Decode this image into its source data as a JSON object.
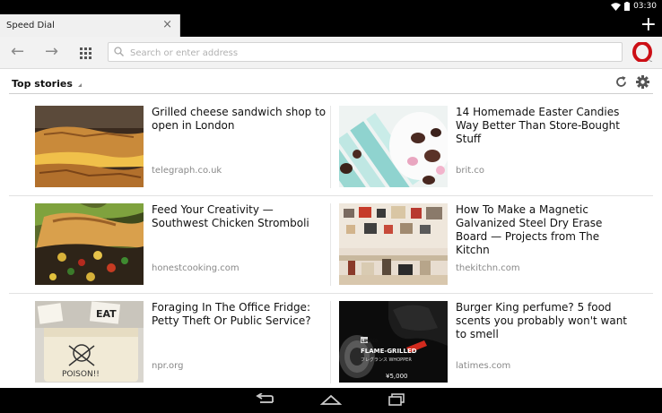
{
  "status": {
    "time": "03:30"
  },
  "tab": {
    "title": "Speed Dial",
    "close": "×",
    "new_tab": "+"
  },
  "toolbar": {
    "back": "←",
    "forward": "→",
    "search_placeholder": "Search or enter address"
  },
  "section": {
    "title": "Top stories"
  },
  "colors": {
    "opera_red": "#cc0f16",
    "thumb_accent_candy": "#8fd3cf"
  },
  "articles": [
    {
      "headline": "Grilled cheese sandwich shop to open in London",
      "source": "telegraph.co.uk"
    },
    {
      "headline": "14 Homemade Easter Candies Way Better Than Store-Bought Stuff",
      "source": "brit.co"
    },
    {
      "headline": "Feed Your Creativity — Southwest Chicken Stromboli",
      "source": "honestcooking.com"
    },
    {
      "headline": "How To Make a Magnetic Galvanized Steel Dry Erase Board — Projects from The Kitchn",
      "source": "thekitchn.com"
    },
    {
      "headline": "Foraging In The Office Fridge: Petty Theft Or Public Service?",
      "source": "npr.org"
    },
    {
      "headline": "Burger King perfume? 5 food scents you probably won't want to smell",
      "source": "latimes.com"
    }
  ],
  "thumb_text": {
    "fridge_sign": "EAT",
    "fridge_label": "POISON!!",
    "bottle_tag": "LIMITED",
    "bottle_title": "FLAME-GRILLED",
    "bottle_sub": "フレグランス WHOPPER",
    "bottle_price": "¥5,000"
  }
}
